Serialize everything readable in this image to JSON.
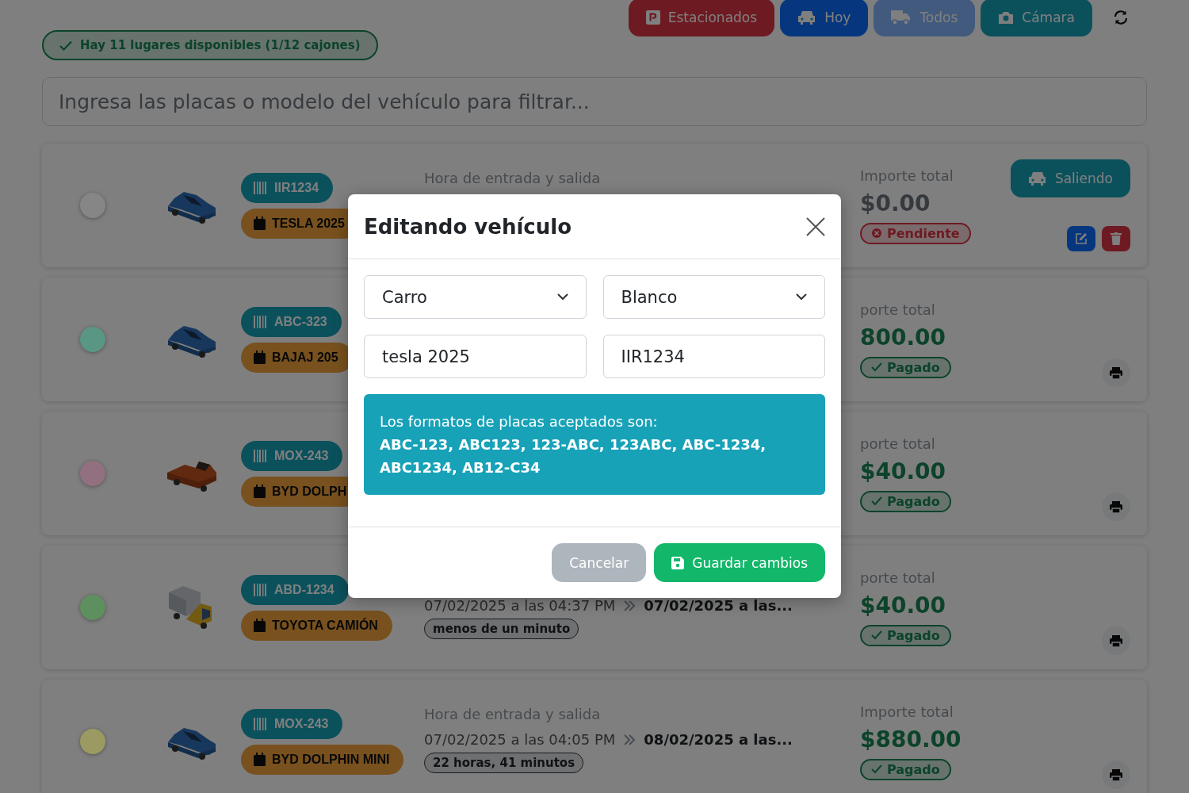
{
  "header": {
    "availability": "Hay 11 lugares disponibles (1/12 cajones)",
    "filters": [
      {
        "label": "Estacionados",
        "disabled": false
      },
      {
        "label": "Hoy",
        "disabled": false
      },
      {
        "label": "Todos",
        "disabled": true
      },
      {
        "label": "Cámara",
        "disabled": false
      }
    ]
  },
  "search": {
    "placeholder": "Ingresa las placas o modelo del vehículo para filtrar..."
  },
  "rows": [
    {
      "kind": "active",
      "color": "#868686",
      "vehicle": {
        "kind": "car"
      },
      "plate": "IIR1234",
      "model": "TESLA 2025",
      "times_label": "Hora de entrada y salida",
      "amount_label": "Importe total",
      "amount": "$0.00",
      "payment": {
        "label": "Pendiente",
        "paid": false
      },
      "exit_button": "Saliendo"
    },
    {
      "kind": "done",
      "color": "#5a9684",
      "vehicle": {
        "kind": "car"
      },
      "plate": "ABC-323",
      "model": "BAJAJ 205",
      "amount_label": "porte total",
      "amount": "800.00",
      "payment": {
        "label": "Pagado",
        "paid": true
      }
    },
    {
      "kind": "done",
      "color": "#927080",
      "vehicle": {
        "kind": "pickup"
      },
      "plate": "MOX-243",
      "model": "BYD DOLPH",
      "amount_label": "porte total",
      "amount": "$40.00",
      "payment": {
        "label": "Pagado",
        "paid": true
      }
    },
    {
      "kind": "done",
      "color": "#5e8f5e",
      "vehicle": {
        "kind": "truck"
      },
      "plate": "ABD-1234",
      "model": "TOYOTA CAMIÓN",
      "entry": "07/02/2025 a las 04:37 PM",
      "exit": "07/02/2025 a las...",
      "duration": "menos de un minuto",
      "amount_label": "porte total",
      "amount": "$40.00",
      "payment": {
        "label": "Pagado",
        "paid": true
      }
    },
    {
      "kind": "done",
      "color": "#9a9a62",
      "vehicle": {
        "kind": "car"
      },
      "plate": "MOX-243",
      "model": "BYD DOLPHIN MINI",
      "times_label": "Hora de entrada y salida",
      "entry": "07/02/2025 a las 04:05 PM",
      "exit": "08/02/2025 a las...",
      "duration": "22 horas, 41 minutos",
      "amount_label": "Importe total",
      "amount": "$880.00",
      "payment": {
        "label": "Pagado",
        "paid": true
      }
    }
  ],
  "modal": {
    "title": "Editando vehículo",
    "selects": [
      "Carro",
      "Blanco"
    ],
    "inputs": [
      "tesla 2025",
      "IIR1234"
    ],
    "alert": "Los formatos de placas aceptados son: **ABC-123, ABC123, 123-ABC, 123ABC, ABC-1234, ABC1234, AB12-C34**",
    "cancel": "Cancelar",
    "save": "Guardar cambios"
  }
}
